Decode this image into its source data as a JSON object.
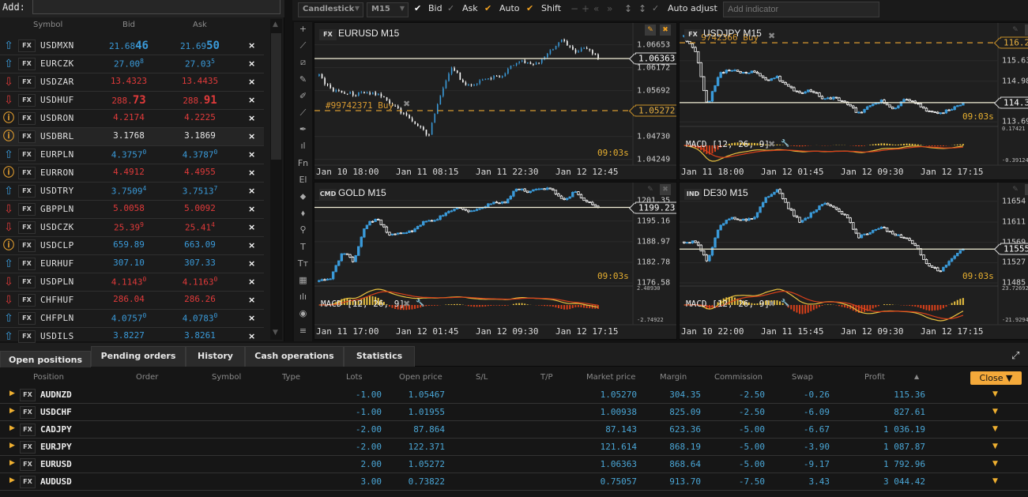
{
  "watchlist": {
    "add_label": "Add:",
    "add_value": "",
    "headers": {
      "symbol": "Symbol",
      "bid": "Bid",
      "ask": "Ask"
    },
    "remove_glyph": "×",
    "colors": {
      "up": "#3a9ad9",
      "down": "#e03a3a",
      "info": "#e6a030",
      "neutral": "#e6e6e6"
    },
    "rows": [
      {
        "icon": "arrow-up",
        "badge": "FX",
        "symbol": "USDMXN",
        "color": "up",
        "bid": {
          "main": "21.68",
          "big": "46",
          "sup": ""
        },
        "ask": {
          "main": "21.69",
          "big": "50",
          "sup": ""
        }
      },
      {
        "icon": "arrow-up",
        "badge": "FX",
        "symbol": "EURCZK",
        "color": "up",
        "bid": {
          "main": "27.00",
          "big": "",
          "sup": "8"
        },
        "ask": {
          "main": "27.03",
          "big": "",
          "sup": "5"
        }
      },
      {
        "icon": "arrow-down",
        "badge": "FX",
        "symbol": "USDZAR",
        "color": "down",
        "bid": {
          "main": "13.4323",
          "big": "",
          "sup": ""
        },
        "ask": {
          "main": "13.4435",
          "big": "",
          "sup": ""
        }
      },
      {
        "icon": "arrow-down",
        "badge": "FX",
        "symbol": "USDHUF",
        "color": "down",
        "bid": {
          "main": "288.",
          "big": "73",
          "sup": ""
        },
        "ask": {
          "main": "288.",
          "big": "91",
          "sup": ""
        }
      },
      {
        "icon": "info",
        "badge": "FX",
        "symbol": "USDRON",
        "color": "down",
        "bid": {
          "main": "4.2174",
          "big": "",
          "sup": ""
        },
        "ask": {
          "main": "4.2225",
          "big": "",
          "sup": ""
        }
      },
      {
        "icon": "info",
        "badge": "FX",
        "symbol": "USDBRL",
        "color": "neutral",
        "selected": true,
        "bid": {
          "main": "3.1768",
          "big": "",
          "sup": ""
        },
        "ask": {
          "main": "3.1869",
          "big": "",
          "sup": ""
        }
      },
      {
        "icon": "arrow-up",
        "badge": "FX",
        "symbol": "EURPLN",
        "color": "up",
        "bid": {
          "main": "4.3757",
          "big": "",
          "sup": "0"
        },
        "ask": {
          "main": "4.3787",
          "big": "",
          "sup": "0"
        }
      },
      {
        "icon": "info",
        "badge": "FX",
        "symbol": "EURRON",
        "color": "down",
        "bid": {
          "main": "4.4912",
          "big": "",
          "sup": ""
        },
        "ask": {
          "main": "4.4955",
          "big": "",
          "sup": ""
        }
      },
      {
        "icon": "arrow-up",
        "badge": "FX",
        "symbol": "USDTRY",
        "color": "up",
        "bid": {
          "main": "3.7509",
          "big": "",
          "sup": "4"
        },
        "ask": {
          "main": "3.7513",
          "big": "",
          "sup": "7"
        }
      },
      {
        "icon": "arrow-down",
        "badge": "FX",
        "symbol": "GBPPLN",
        "color": "down",
        "bid": {
          "main": "5.0058",
          "big": "",
          "sup": ""
        },
        "ask": {
          "main": "5.0092",
          "big": "",
          "sup": ""
        }
      },
      {
        "icon": "arrow-down",
        "badge": "FX",
        "symbol": "USDCZK",
        "color": "down",
        "bid": {
          "main": "25.39",
          "big": "",
          "sup": "9"
        },
        "ask": {
          "main": "25.41",
          "big": "",
          "sup": "4"
        }
      },
      {
        "icon": "info",
        "badge": "FX",
        "symbol": "USDCLP",
        "color": "up",
        "bid": {
          "main": "659.89",
          "big": "",
          "sup": ""
        },
        "ask": {
          "main": "663.09",
          "big": "",
          "sup": ""
        }
      },
      {
        "icon": "arrow-up",
        "badge": "FX",
        "symbol": "EURHUF",
        "color": "up",
        "bid": {
          "main": "307.10",
          "big": "",
          "sup": ""
        },
        "ask": {
          "main": "307.33",
          "big": "",
          "sup": ""
        }
      },
      {
        "icon": "arrow-down",
        "badge": "FX",
        "symbol": "USDPLN",
        "color": "down",
        "bid": {
          "main": "4.1143",
          "big": "",
          "sup": "0"
        },
        "ask": {
          "main": "4.1163",
          "big": "",
          "sup": "0"
        }
      },
      {
        "icon": "arrow-down",
        "badge": "FX",
        "symbol": "CHFHUF",
        "color": "down",
        "bid": {
          "main": "286.04",
          "big": "",
          "sup": ""
        },
        "ask": {
          "main": "286.26",
          "big": "",
          "sup": ""
        }
      },
      {
        "icon": "arrow-up",
        "badge": "FX",
        "symbol": "CHFPLN",
        "color": "up",
        "bid": {
          "main": "4.0757",
          "big": "",
          "sup": "0"
        },
        "ask": {
          "main": "4.0783",
          "big": "",
          "sup": "0"
        }
      },
      {
        "icon": "arrow-up",
        "badge": "FX",
        "symbol": "USDILS",
        "color": "up",
        "bid": {
          "main": "3.8227",
          "big": "",
          "sup": ""
        },
        "ask": {
          "main": "3.8261",
          "big": "",
          "sup": ""
        }
      }
    ]
  },
  "toolbar": {
    "chart_type": "Candlestick",
    "timeframe": "M15",
    "bid": "Bid",
    "ask": "Ask",
    "auto": "Auto",
    "shift": "Shift",
    "auto_adjust": "Auto adjust",
    "add_indicator_placeholder": "Add indicator"
  },
  "tools": [
    "+",
    "⟋",
    "⧄",
    "✎",
    "✐",
    "⟋",
    "✒",
    "ıl",
    "Fn",
    "El",
    "⬥",
    "⬧",
    "⚲",
    "T",
    "Tт",
    "▦",
    "ılı",
    "◉",
    "≡"
  ],
  "charts": [
    {
      "badge": "FX",
      "title": "EURUSD M15",
      "ylim": [
        1.0413,
        1.0711
      ],
      "path": [
        1.06,
        1.057,
        1.0565,
        1.0562,
        1.0565,
        1.056,
        1.054,
        1.052,
        1.05,
        1.0475,
        1.056,
        1.062,
        1.058,
        1.0585,
        1.0595,
        1.06,
        1.0625,
        1.063,
        1.0625,
        1.065,
        1.0675,
        1.065,
        1.066,
        1.0636
      ],
      "ticks": [
        "1.06653",
        "1.06172",
        "1.05692",
        "1.04730",
        "1.04249"
      ],
      "current": {
        "value": 1.06363,
        "label": "1.06363"
      },
      "order": {
        "value": 1.05272,
        "label": "#99742371 Buy",
        "price_label": "1.05272"
      },
      "countdown": "09:03s",
      "xticks": [
        "Jan 10 18:00",
        "Jan 11 08:15",
        "Jan 11 22:30",
        "Jan 12 12:45"
      ],
      "candle_style": "bars"
    },
    {
      "badge": "FX",
      "title": "USDJPY M15",
      "ylim": [
        113.57,
        116.83
      ],
      "path": [
        116.4,
        115.9,
        114.2,
        115.2,
        115.35,
        115.25,
        115.3,
        115.0,
        115.1,
        114.8,
        114.6,
        114.7,
        114.4,
        114.45,
        114.3,
        113.95,
        114.2,
        114.35,
        114.1,
        114.4,
        114.3,
        114.0,
        113.95,
        114.1,
        114.3
      ],
      "ticks": [
        "115.63",
        "114.98",
        "113.69"
      ],
      "current": {
        "value": 114.3,
        "label": "114.3"
      },
      "order": {
        "value": 116.2,
        "label": "#99742366 Buy",
        "price_label": "116.2"
      },
      "countdown": "09:03s",
      "xticks": [
        "Jan 11 18:00",
        "Jan 12 01:45",
        "Jan 12 09:30",
        "Jan 12 17:15"
      ],
      "macd": {
        "label": "MACD [12, 26, 9]",
        "max_label": "0.17421",
        "min_label": "-0.39124"
      }
    },
    {
      "badge": "CMD",
      "title": "GOLD M15",
      "ylim": [
        1175.9,
        1206.7
      ],
      "path": [
        1177,
        1178,
        1186,
        1183,
        1194,
        1196,
        1191,
        1191.5,
        1192,
        1195,
        1195.5,
        1198,
        1199,
        1198,
        1199,
        1201,
        1200.5,
        1205,
        1204,
        1204.5,
        1205,
        1201,
        1204,
        1201,
        1199.2
      ],
      "ticks": [
        "1201.35",
        "1195.16",
        "1188.97",
        "1182.78",
        "1176.58"
      ],
      "current": {
        "value": 1199.23,
        "label": "1199.23"
      },
      "countdown": "09:03s",
      "xticks": [
        "Jan 11 17:00",
        "Jan 12 01:45",
        "Jan 12 09:30",
        "Jan 12 17:15"
      ],
      "macd": {
        "label": "MACD [12, 26, 9]",
        "max_label": "2.48930",
        "min_label": "-2.74922"
      }
    },
    {
      "badge": "IND",
      "title": "DE30 M15",
      "ylim": [
        11480,
        11693
      ],
      "path": [
        11570,
        11570,
        11530,
        11600,
        11620,
        11615,
        11620,
        11660,
        11680,
        11640,
        11610,
        11630,
        11650,
        11640,
        11620,
        11580,
        11590,
        11600,
        11585,
        11580,
        11560,
        11520,
        11510,
        11535,
        11555
      ],
      "ticks": [
        "11654",
        "11611",
        "11569",
        "11527",
        "11485"
      ],
      "current": {
        "value": 11555,
        "label": "11555"
      },
      "countdown": "09:03s",
      "xticks": [
        "Jan 10 22:00",
        "Jan 11 15:45",
        "Jan 12 09:30",
        "Jan 12 17:15"
      ],
      "macd": {
        "label": "MACD [12, 26, 9]",
        "max_label": "23.72692",
        "min_label": "-21.92949"
      }
    }
  ],
  "chart_colors": {
    "up": "#3a9ad9",
    "down": "#ffffff",
    "price_line": "#f4f0d8",
    "order_line": "#d89a30",
    "macd": "#e8c040",
    "signal": "#d8401a"
  },
  "bottom": {
    "tabs": [
      "Open positions",
      "Pending orders",
      "History",
      "Cash operations",
      "Statistics"
    ],
    "active_tab": 0,
    "columns": [
      "Position",
      "Order",
      "Symbol",
      "Type",
      "Lots",
      "Open price",
      "S/L",
      "T/P",
      "Market price",
      "Margin",
      "Commission",
      "Swap",
      "Profit"
    ],
    "sort_indicator": "▲",
    "close_label": "Close ▼",
    "rows": [
      {
        "badge": "FX",
        "position": "AUDNZD",
        "lots": "-1.00",
        "open_price": "1.05467",
        "market_price": "1.05270",
        "margin": "304.35",
        "commission": "-2.50",
        "swap": "-0.26",
        "profit": "115.36"
      },
      {
        "badge": "FX",
        "position": "USDCHF",
        "lots": "-1.00",
        "open_price": "1.01955",
        "market_price": "1.00938",
        "margin": "825.09",
        "commission": "-2.50",
        "swap": "-6.09",
        "profit": "827.61"
      },
      {
        "badge": "FX",
        "position": "CADJPY",
        "lots": "-2.00",
        "open_price": "87.864",
        "market_price": "87.143",
        "margin": "623.36",
        "commission": "-5.00",
        "swap": "-6.67",
        "profit": "1 036.19"
      },
      {
        "badge": "FX",
        "position": "EURJPY",
        "lots": "-2.00",
        "open_price": "122.371",
        "market_price": "121.614",
        "margin": "868.19",
        "commission": "-5.00",
        "swap": "-3.90",
        "profit": "1 087.87"
      },
      {
        "badge": "FX",
        "position": "EURUSD",
        "lots": "2.00",
        "open_price": "1.05272",
        "market_price": "1.06363",
        "margin": "868.64",
        "commission": "-5.00",
        "swap": "-9.17",
        "profit": "1 792.96"
      },
      {
        "badge": "FX",
        "position": "AUDUSD",
        "lots": "3.00",
        "open_price": "0.73822",
        "market_price": "0.75057",
        "margin": "913.70",
        "commission": "-7.50",
        "swap": "3.43",
        "profit": "3 044.42"
      }
    ]
  }
}
